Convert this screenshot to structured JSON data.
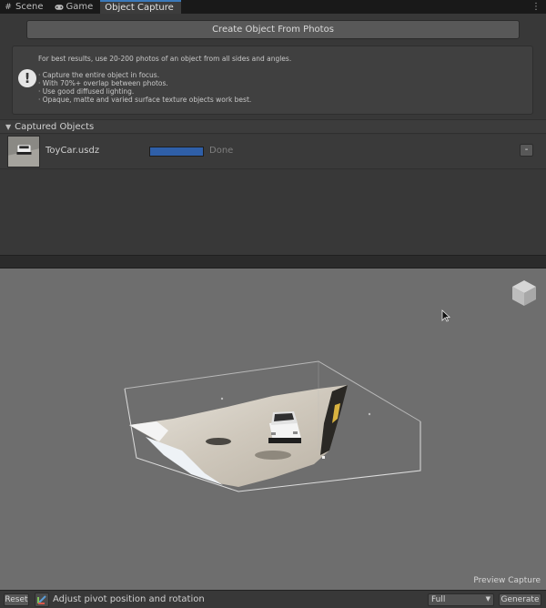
{
  "tabs": [
    {
      "label": "Scene",
      "icon": "grid-icon"
    },
    {
      "label": "Game",
      "icon": "gamepad-icon"
    },
    {
      "label": "Object Capture",
      "icon": null,
      "active": true
    }
  ],
  "top": {
    "create_button": "Create Object From Photos",
    "help": {
      "lead": "For best results, use 20-200 photos of an object from all sides and angles.",
      "tips": [
        "· Capture the entire object in focus.",
        "· With 70%+ overlap between photos.",
        "· Use good diffused lighting.",
        "· Opaque, matte and varied surface texture objects work best."
      ]
    },
    "section_title": "Captured Objects",
    "objects": [
      {
        "name": "ToyCar.usdz",
        "progress": 1.0,
        "status": "Done",
        "remove_label": "-"
      }
    ]
  },
  "preview": {
    "label": "Preview Capture",
    "background": "#6e6e6e"
  },
  "bottom": {
    "reset_label": "Reset",
    "pivot_label": "Adjust pivot position and rotation",
    "detail_value": "Full",
    "generate_label": "Generate"
  },
  "colors": {
    "accent": "#3a79bb",
    "progress": "#2f5fa8",
    "panel": "#383838"
  }
}
